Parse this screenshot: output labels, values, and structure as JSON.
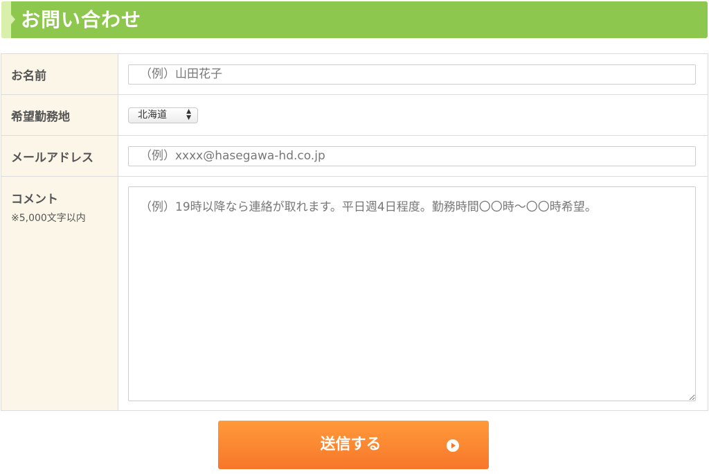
{
  "header": {
    "title": "お問い合わせ"
  },
  "form": {
    "name": {
      "label": "お名前",
      "placeholder": "（例）山田花子"
    },
    "location": {
      "label": "希望勤務地",
      "selected": "北海道"
    },
    "email": {
      "label": "メールアドレス",
      "placeholder": "（例）xxxx@hasegawa-hd.co.jp"
    },
    "comment": {
      "label": "コメント",
      "note": "※5,000文字以内",
      "placeholder": "（例）19時以降なら連絡が取れます。平日週4日程度。勤務時間〇〇時〜〇〇時希望。"
    }
  },
  "submit": {
    "label": "送信する"
  },
  "colors": {
    "header_bg": "#8dc74d",
    "label_bg": "#fcf6e8",
    "submit_bg": "#f7772a"
  },
  "icons": {
    "submit": "play-circle-icon",
    "select": "select-arrows-icon",
    "resize": "resize-handle-icon"
  }
}
